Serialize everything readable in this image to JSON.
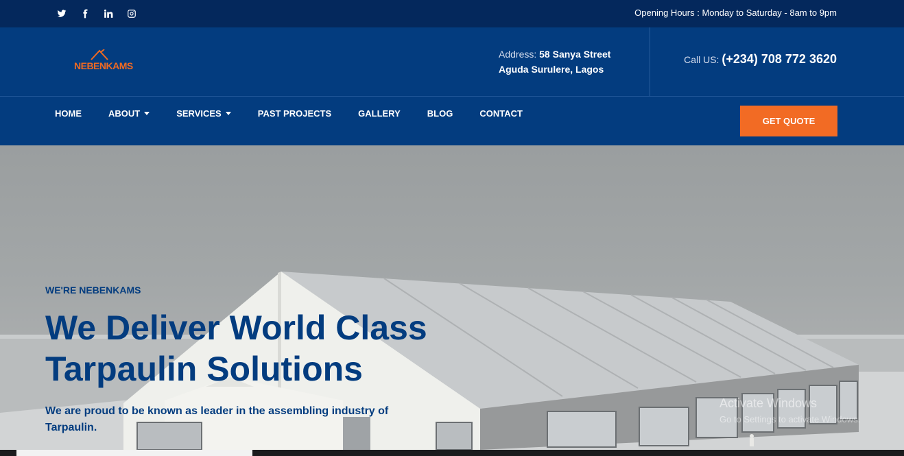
{
  "topbar": {
    "social": [
      "twitter-icon",
      "facebook-icon",
      "linkedin-icon",
      "instagram-icon"
    ],
    "hours": "Opening Hours : Monday to Saturday - 8am to 9pm"
  },
  "header": {
    "logo_text": "NEBENKAMS",
    "address_label": "Address:",
    "address_line1": "58 Sanya Street",
    "address_line2": "Aguda Surulere, Lagos",
    "call_label": "Call US:",
    "phone": "(+234) 708 772 3620"
  },
  "nav": {
    "items": [
      {
        "label": "HOME",
        "dropdown": false
      },
      {
        "label": "ABOUT",
        "dropdown": true
      },
      {
        "label": "SERVICES",
        "dropdown": true
      },
      {
        "label": "PAST PROJECTS",
        "dropdown": false
      },
      {
        "label": "GALLERY",
        "dropdown": false
      },
      {
        "label": "BLOG",
        "dropdown": false
      },
      {
        "label": "CONTACT",
        "dropdown": false
      }
    ],
    "cta": "GET QUOTE"
  },
  "hero": {
    "eyebrow": "WE'RE NEBENKAMS",
    "headline_line1": "We Deliver World Class",
    "headline_line2": "Tarpaulin Solutions",
    "subtext": "We are proud to be known as leader in the assembling industry of Tarpaulin."
  },
  "watermark": {
    "title": "Activate Windows",
    "subtitle": "Go to Settings to activate Windows."
  },
  "colors": {
    "topbar": "#04285c",
    "header": "#033c7f",
    "accent": "#f26b24"
  }
}
